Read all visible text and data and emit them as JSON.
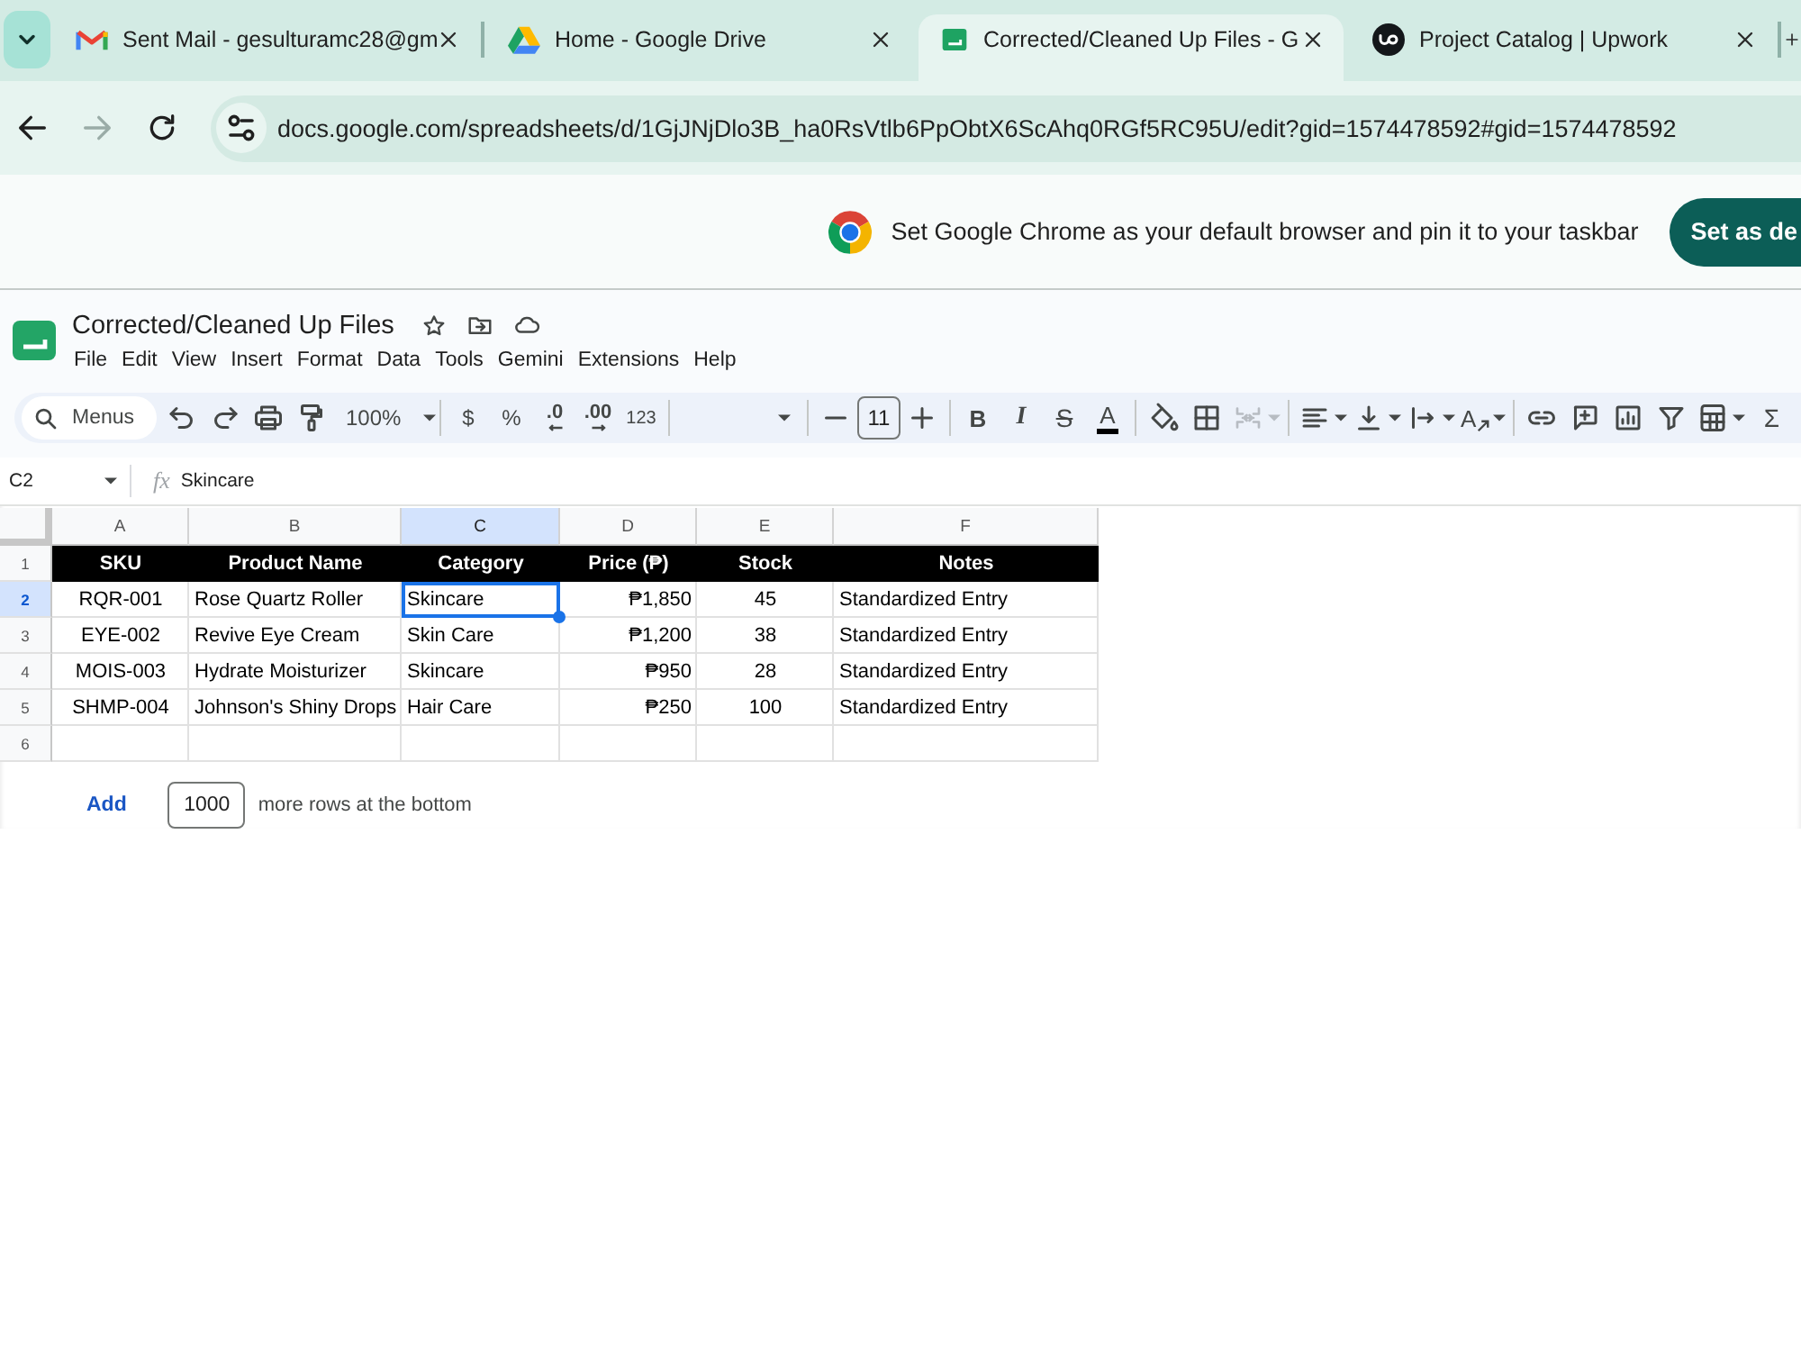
{
  "browser": {
    "tabs": [
      {
        "kind": "mail",
        "title": "Sent Mail - gesulturamc28@gm",
        "selected": false
      },
      {
        "kind": "drive",
        "title": "Home - Google Drive",
        "selected": false
      },
      {
        "kind": "sheets",
        "title": "Corrected/Cleaned Up Files - G",
        "selected": true
      },
      {
        "kind": "web",
        "title": "Project Catalog | Upwork",
        "selected": false
      }
    ],
    "nav": [
      {
        "kind": "back",
        "disabled": false
      },
      {
        "kind": "forward",
        "disabled": true
      },
      {
        "kind": "reload",
        "disabled": false
      }
    ],
    "url": "docs.google.com/spreadsheets/d/1GjJNjDlo3B_ha0RsVtlb6PpObtX6ScAhq0RGf5RC95U/edit?gid=1574478592#gid=1574478592"
  },
  "banner": {
    "text": "Set Google Chrome as your default browser and pin it to your taskbar",
    "button": "Set as de"
  },
  "document": {
    "title": "Corrected/Cleaned Up Files",
    "menu": [
      "File",
      "Edit",
      "View",
      "Insert",
      "Format",
      "Data",
      "Tools",
      "Gemini",
      "Extensions",
      "Help"
    ]
  },
  "toolbar": {
    "search": {
      "placeholder": "Menus"
    },
    "zoom": "100%",
    "currency": "$",
    "percent": "%",
    "decrease_decimal": ".0",
    "increase_decimal": ".00",
    "more_formats": "123",
    "font_size": "11",
    "bold": "B",
    "italic": "I",
    "strikethrough": "S",
    "text_color": "A",
    "merge_cells": {
      "disabled": true
    },
    "text_rotation": "A",
    "functions": "Σ"
  },
  "formula_bar": {
    "cell": "C2",
    "label": "fx",
    "value": "Skincare"
  },
  "grid": {
    "columns": [
      {
        "letter": "A",
        "selected": false
      },
      {
        "letter": "B",
        "selected": false
      },
      {
        "letter": "C",
        "selected": true
      },
      {
        "letter": "D",
        "selected": false
      },
      {
        "letter": "E",
        "selected": false
      },
      {
        "letter": "F",
        "selected": false
      }
    ],
    "rows": [
      {
        "number": "1",
        "kind": "header",
        "selected": false,
        "cells": [
          {
            "text": "SKU",
            "selected": false
          },
          {
            "text": "Product Name",
            "selected": false
          },
          {
            "text": "Category",
            "selected": false
          },
          {
            "text": "Price (₱)",
            "selected": false
          },
          {
            "text": "Stock",
            "selected": false
          },
          {
            "text": "Notes",
            "selected": false
          }
        ]
      },
      {
        "number": "2",
        "kind": "data",
        "selected": true,
        "cells": [
          {
            "text": "RQR-001",
            "selected": false
          },
          {
            "text": "Rose Quartz Roller",
            "selected": false
          },
          {
            "text": "Skincare",
            "selected": true
          },
          {
            "text": "₱1,850",
            "selected": false
          },
          {
            "text": "45",
            "selected": false
          },
          {
            "text": "Standardized Entry",
            "selected": false
          }
        ]
      },
      {
        "number": "3",
        "kind": "data",
        "selected": false,
        "cells": [
          {
            "text": "EYE-002",
            "selected": false
          },
          {
            "text": "Revive Eye Cream",
            "selected": false
          },
          {
            "text": "Skin Care",
            "selected": false
          },
          {
            "text": "₱1,200",
            "selected": false
          },
          {
            "text": "38",
            "selected": false
          },
          {
            "text": "Standardized Entry",
            "selected": false
          }
        ]
      },
      {
        "number": "4",
        "kind": "data",
        "selected": false,
        "cells": [
          {
            "text": "MOIS-003",
            "selected": false
          },
          {
            "text": "Hydrate Moisturizer",
            "selected": false
          },
          {
            "text": "Skincare",
            "selected": false
          },
          {
            "text": "₱950",
            "selected": false
          },
          {
            "text": "28",
            "selected": false
          },
          {
            "text": "Standardized Entry",
            "selected": false
          }
        ]
      },
      {
        "number": "5",
        "kind": "data",
        "selected": false,
        "cells": [
          {
            "text": "SHMP-004",
            "selected": false
          },
          {
            "text": "Johnson's Shiny Drops",
            "selected": false
          },
          {
            "text": "Hair Care",
            "selected": false
          },
          {
            "text": "₱250",
            "selected": false
          },
          {
            "text": "100",
            "selected": false
          },
          {
            "text": "Standardized Entry",
            "selected": false
          }
        ]
      },
      {
        "number": "6",
        "kind": "data",
        "selected": false
      }
    ]
  },
  "add_rows": {
    "button": "Add",
    "count": "1000",
    "label": "more rows at the bottom"
  }
}
